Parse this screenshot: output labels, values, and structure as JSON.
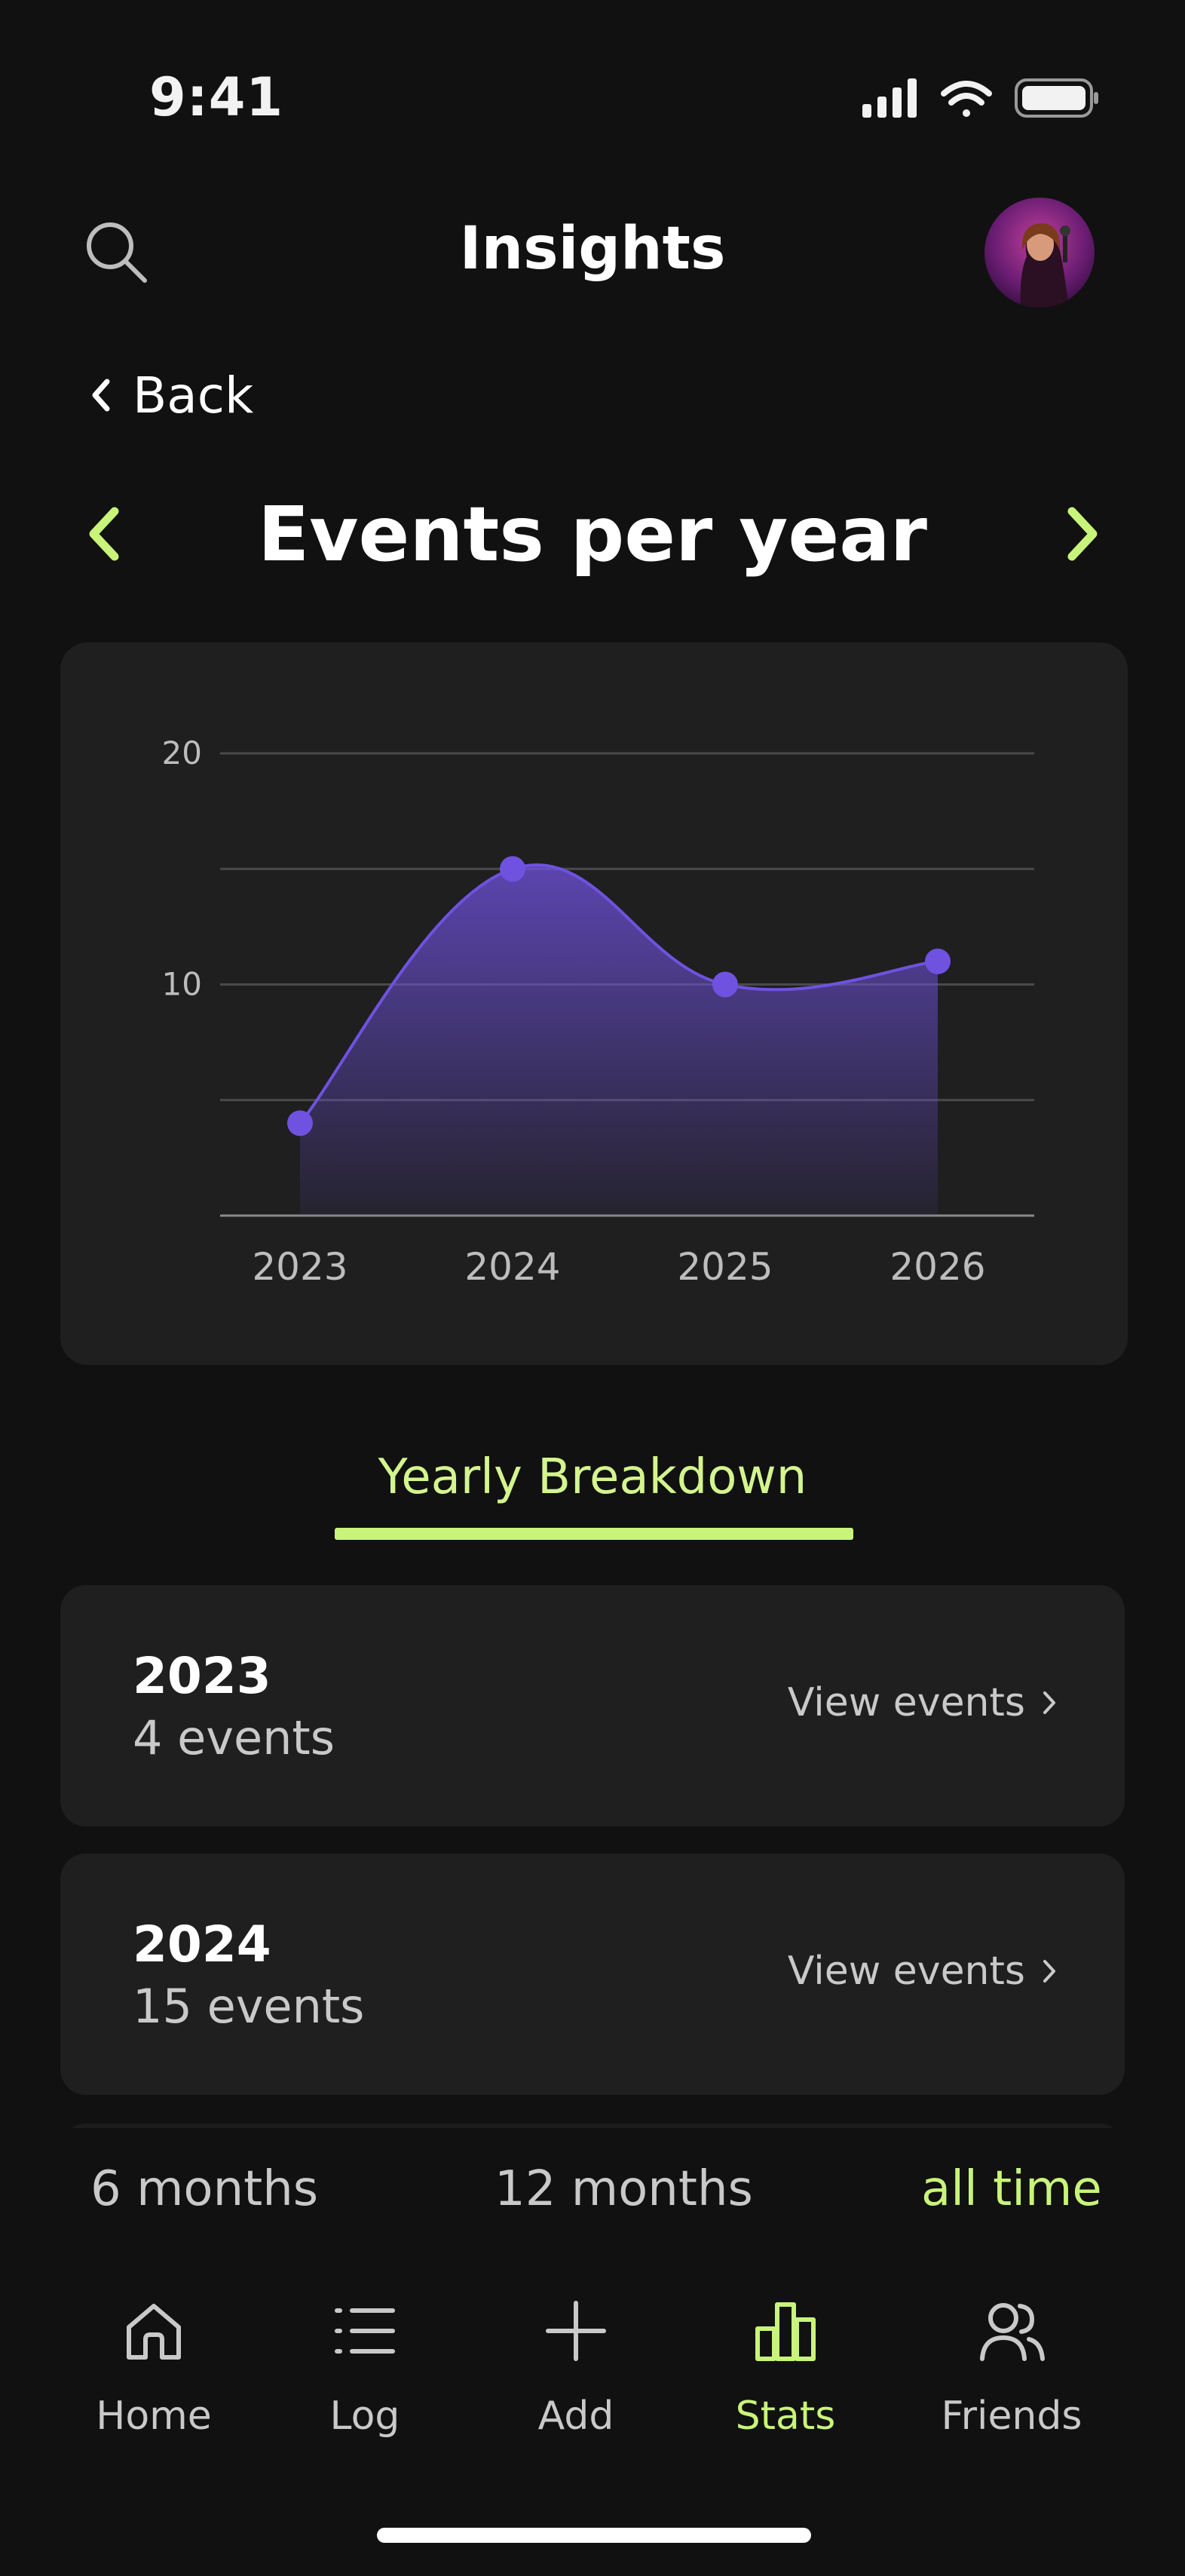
{
  "status_bar": {
    "time": "9:41"
  },
  "header": {
    "title": "Insights",
    "search_icon": "search-icon",
    "avatar_icon": "avatar"
  },
  "back": {
    "label": "Back"
  },
  "chart_header": {
    "title": "Events per year"
  },
  "chart_data": {
    "type": "area",
    "categories": [
      "2023",
      "2024",
      "2025",
      "2026"
    ],
    "values": [
      4,
      15,
      10,
      11
    ],
    "y_ticks": [
      "20",
      "10"
    ],
    "ylim": [
      0,
      20
    ],
    "grid": true,
    "series_color": "#6f52e0"
  },
  "tab": {
    "label": "Yearly Breakdown"
  },
  "breakdown": [
    {
      "year": "2023",
      "count": "4 events",
      "action": "View events"
    },
    {
      "year": "2024",
      "count": "15 events",
      "action": "View events"
    }
  ],
  "range": {
    "options": [
      "6 months",
      "12 months",
      "all time"
    ],
    "active": "all time"
  },
  "tabbar": {
    "items": [
      {
        "label": "Home",
        "icon": "home-icon"
      },
      {
        "label": "Log",
        "icon": "list-icon"
      },
      {
        "label": "Add",
        "icon": "plus-icon"
      },
      {
        "label": "Stats",
        "icon": "bar-chart-icon"
      },
      {
        "label": "Friends",
        "icon": "users-icon"
      }
    ],
    "active": "Stats"
  },
  "colors": {
    "background": "#111111",
    "card": "#1f1f1f",
    "accent": "#c8f47a",
    "chart": "#6f52e0"
  }
}
